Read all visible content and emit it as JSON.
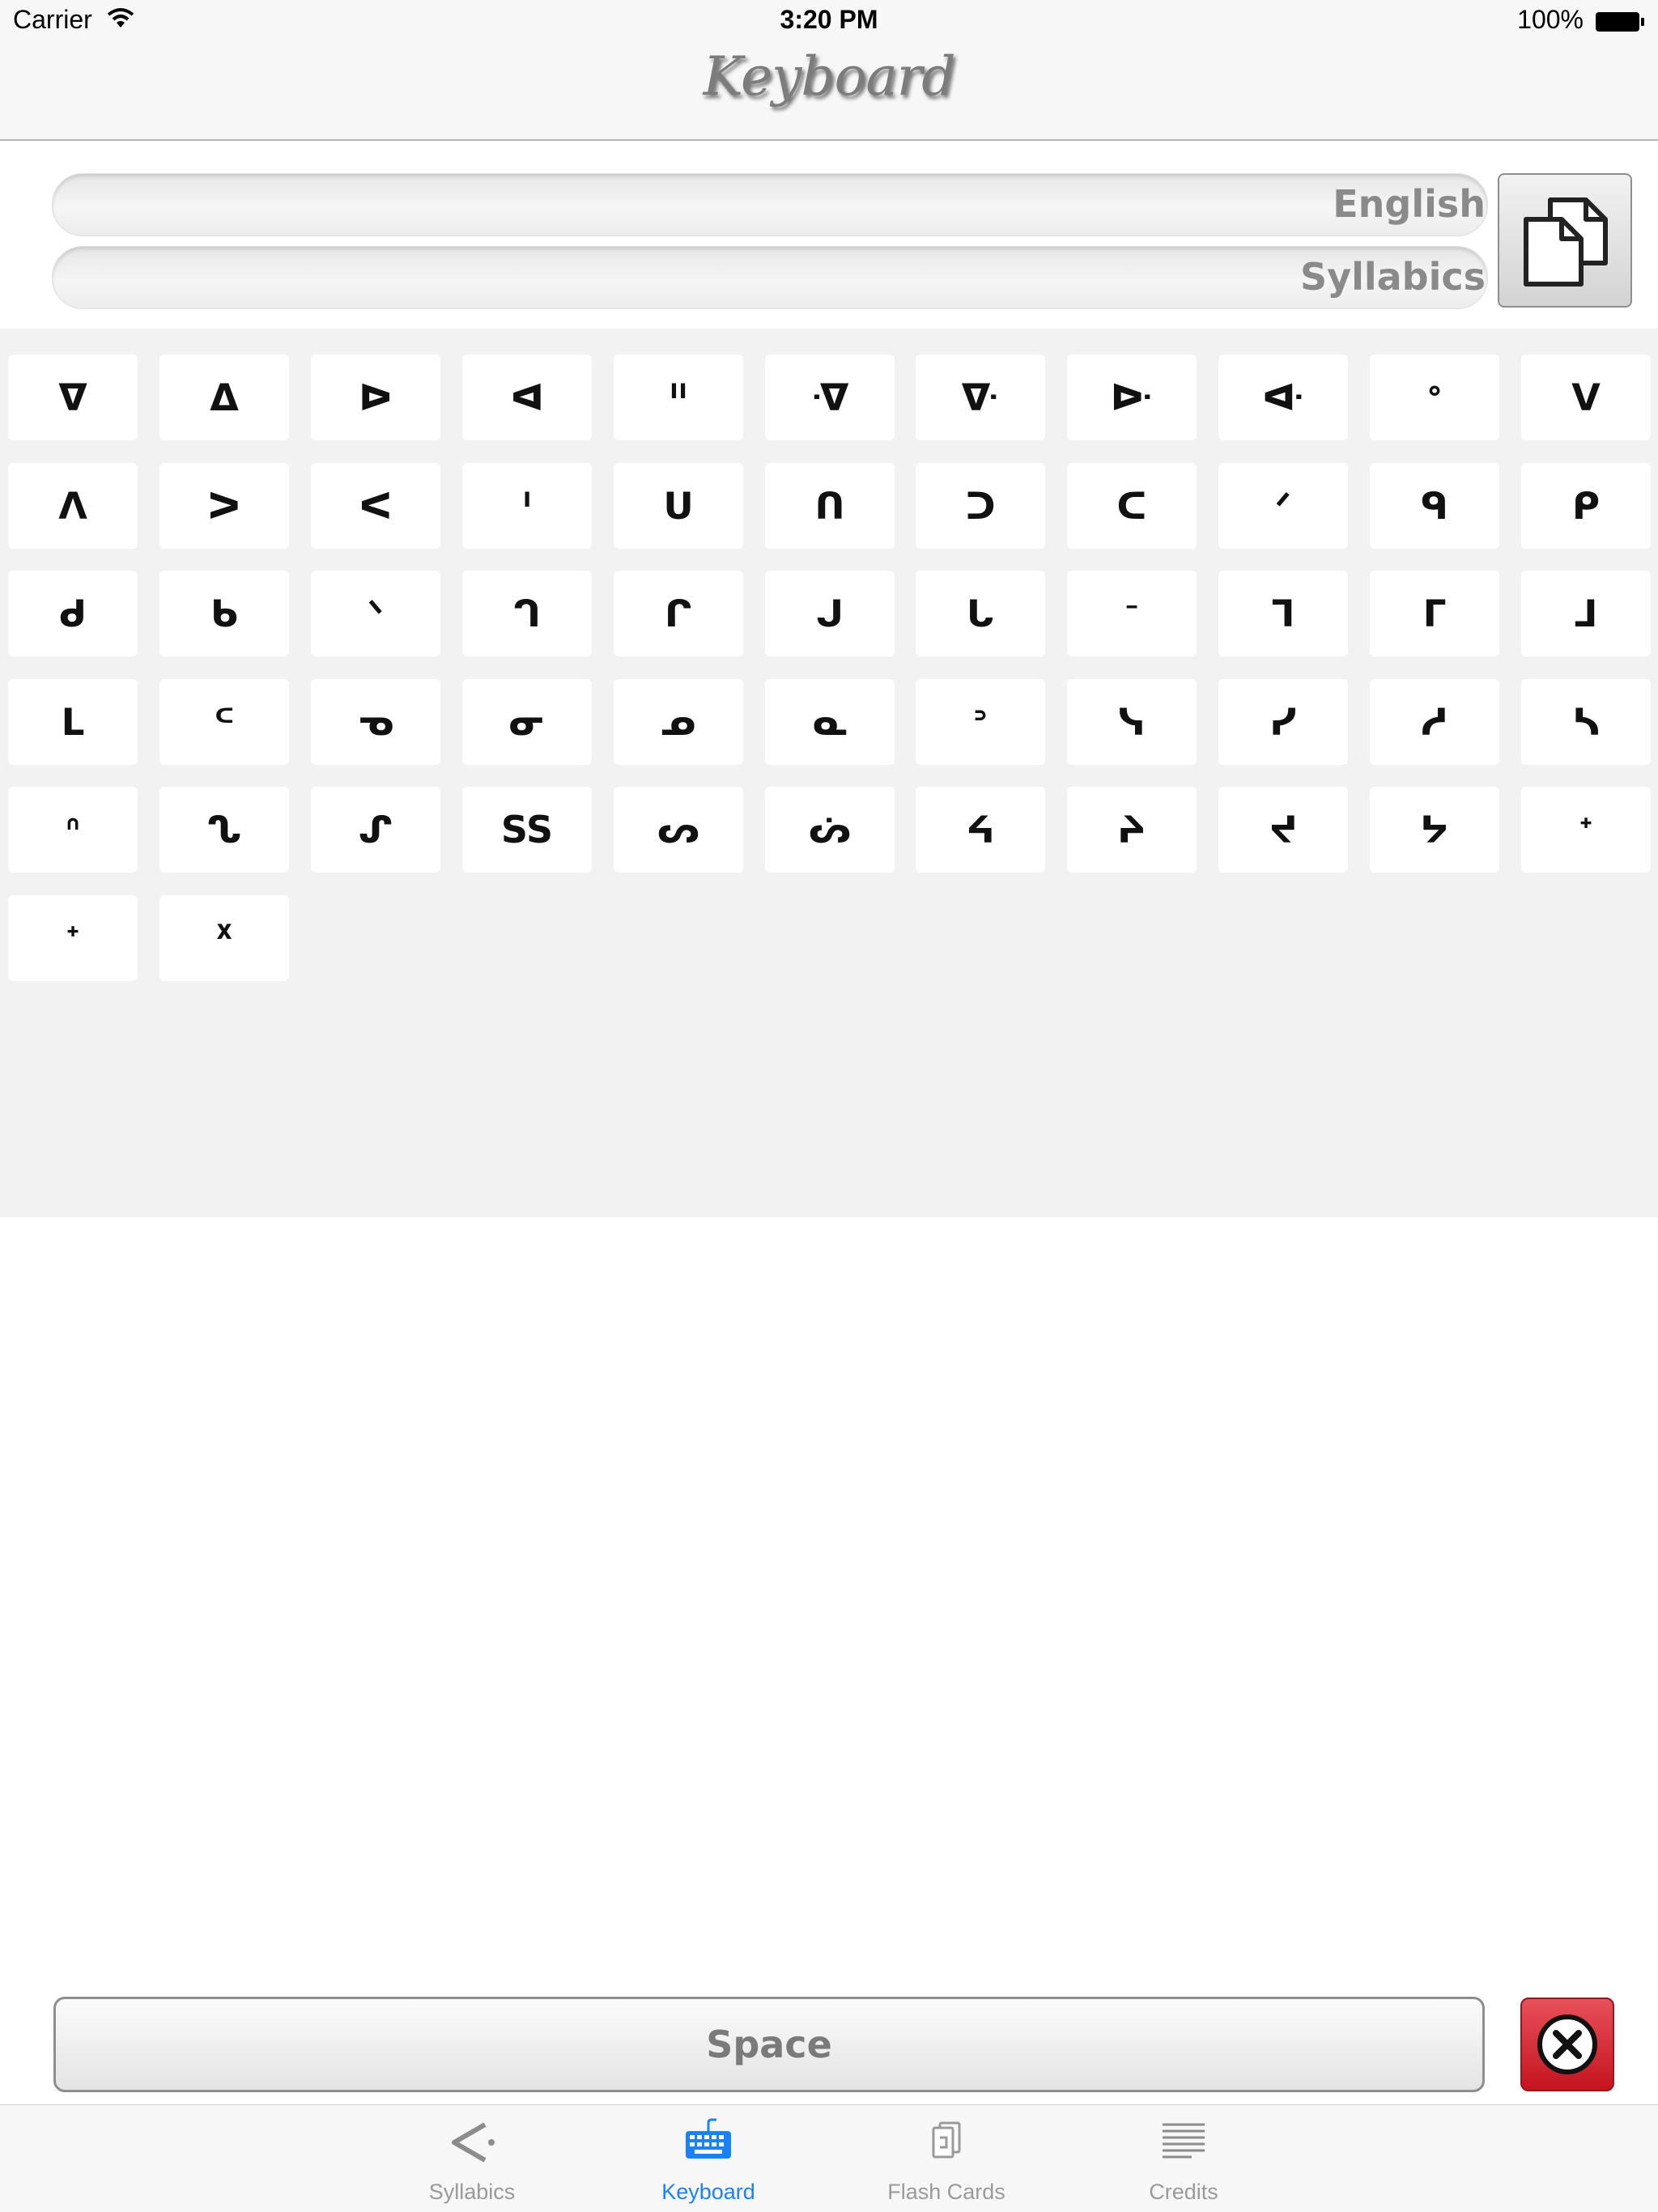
{
  "status_bar": {
    "carrier": "Carrier",
    "time": "3:20 PM",
    "battery": "100%"
  },
  "nav": {
    "title": "Keyboard"
  },
  "fields": {
    "english_placeholder": "English",
    "syllabics_placeholder": "Syllabics"
  },
  "keyboard": {
    "rows": [
      [
        "ᐁ",
        "ᐃ",
        "ᐅ",
        "ᐊ",
        "ᐦ",
        "ᐌ",
        "ᐍ",
        "ᐓ",
        "ᐘ",
        "ᐤ",
        "ᐯ"
      ],
      [
        "ᐱ",
        "ᐳ",
        "ᐸ",
        "ᑊ",
        "ᑌ",
        "ᑎ",
        "ᑐ",
        "ᑕ",
        "ᐟ",
        "ᑫ",
        "ᑭ"
      ],
      [
        "ᑯ",
        "ᑲ",
        "ᐠ",
        "ᒉ",
        "ᒋ",
        "ᒍ",
        "ᒐ",
        "ᐨ",
        "ᒣ",
        "ᒥ",
        "ᒧ"
      ],
      [
        "ᒪ",
        "ᒼ",
        "ᓀ",
        "ᓂ",
        "ᓄ",
        "ᓇ",
        "ᐣ",
        "ᓭ",
        "ᓯ",
        "ᓱ",
        "ᓴ"
      ],
      [
        "ᐢ",
        "ᔐ",
        "ᔑ",
        "SS",
        "ᔕ",
        "ᔖ",
        "ᔦ",
        "ᔨ",
        "ᔪ",
        "ᔭ",
        "ᐩ"
      ],
      [
        "ᕀ",
        "ᕁ"
      ]
    ]
  },
  "bottom": {
    "space_label": "Space"
  },
  "tabbar": {
    "tabs": [
      {
        "label": "Syllabics",
        "icon": "syllabics-icon",
        "active": false
      },
      {
        "label": "Keyboard",
        "icon": "keyboard-icon",
        "active": true
      },
      {
        "label": "Flash Cards",
        "icon": "flash-cards-icon",
        "active": false
      },
      {
        "label": "Credits",
        "icon": "credits-icon",
        "active": false
      }
    ],
    "active_color": "#1a82f7",
    "inactive_color": "#9a9a9a"
  },
  "colors": {
    "delete_button": "#d0232d",
    "keyboard_background": "#f2f2f2"
  }
}
